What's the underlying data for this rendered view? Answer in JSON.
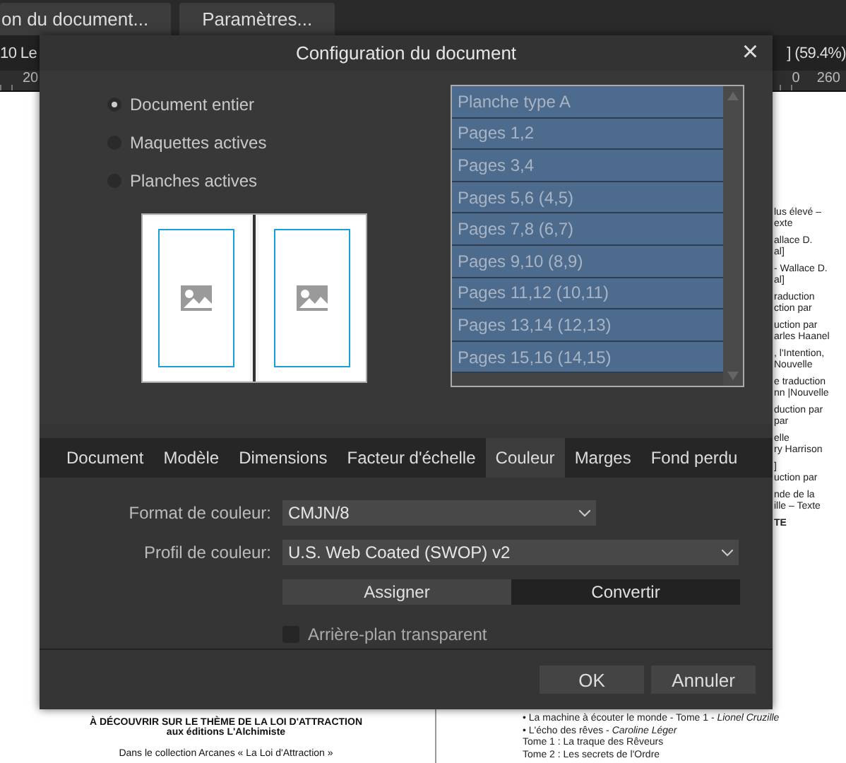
{
  "toolbar": {
    "buttons": [
      "on du document...",
      "Paramètres..."
    ]
  },
  "context_bar": {
    "left_text": "10 Le",
    "right_text": "] (59.4%)"
  },
  "ruler": {
    "labels": [
      "20",
      "0",
      "260"
    ]
  },
  "document": {
    "left_page": [
      "À DÉCOUVRIR SUR LE THÈME DE LA LOI D'ATTRACTION",
      "aux éditions L'Alchimiste",
      "Dans le collection Arcanes « La Loi d'Attraction »"
    ],
    "right_fragments": [
      "lus élevé –",
      "exte",
      "allace D.",
      "al]",
      "- Wallace D.",
      "al]",
      "raduction",
      "ction par",
      "uction par",
      "arles Haanel",
      ", l'Intention,",
      "Nouvelle",
      "e traduction",
      "nn |Nouvelle",
      "duction par",
      "par",
      "elle",
      "ry Harrison",
      "]",
      "uction par",
      "nde de la",
      "ille – Texte",
      "TE"
    ],
    "right_list": [
      "• La machine à écouter le monde - Tome 1 - *Lionel Cruzille*",
      "• L'écho des rêves  - *Caroline Léger*",
      "Tome 1 : La traque des Rêveurs",
      "Tome 2 : Les secrets de l'Ordre"
    ]
  },
  "dialog": {
    "title": "Configuration du document",
    "close": "×",
    "scope_options": [
      {
        "label": "Document entier",
        "selected": true
      },
      {
        "label": "Maquettes actives",
        "selected": false
      },
      {
        "label": "Planches actives",
        "selected": false
      }
    ],
    "spreads": [
      {
        "label": "Planche type A",
        "selected": true
      },
      {
        "label": "Pages 1,2",
        "selected": true
      },
      {
        "label": "Pages 3,4",
        "selected": true
      },
      {
        "label": "Pages 5,6 (4,5)",
        "selected": true
      },
      {
        "label": "Pages 7,8 (6,7)",
        "selected": true
      },
      {
        "label": "Pages 9,10 (8,9)",
        "selected": true
      },
      {
        "label": "Pages 11,12 (10,11)",
        "selected": true
      },
      {
        "label": "Pages 13,14 (12,13)",
        "selected": true
      },
      {
        "label": "Pages 15,16 (14,15)",
        "selected": true
      }
    ],
    "tabs": [
      {
        "label": "Document",
        "selected": false
      },
      {
        "label": "Modèle",
        "selected": false
      },
      {
        "label": "Dimensions",
        "selected": false
      },
      {
        "label": "Facteur d'échelle",
        "selected": false
      },
      {
        "label": "Couleur",
        "selected": true
      },
      {
        "label": "Marges",
        "selected": false
      },
      {
        "label": "Fond perdu",
        "selected": false
      }
    ],
    "color_format": {
      "label": "Format de couleur:",
      "value": "CMJN/8"
    },
    "color_profile": {
      "label": "Profil de couleur:",
      "value": "U.S. Web Coated (SWOP) v2"
    },
    "profile_actions": [
      {
        "label": "Assigner",
        "selected": false
      },
      {
        "label": "Convertir",
        "selected": true
      }
    ],
    "transparent_background": {
      "label": "Arrière-plan transparent",
      "checked": false
    },
    "buttons": [
      "OK",
      "Annuler"
    ]
  }
}
